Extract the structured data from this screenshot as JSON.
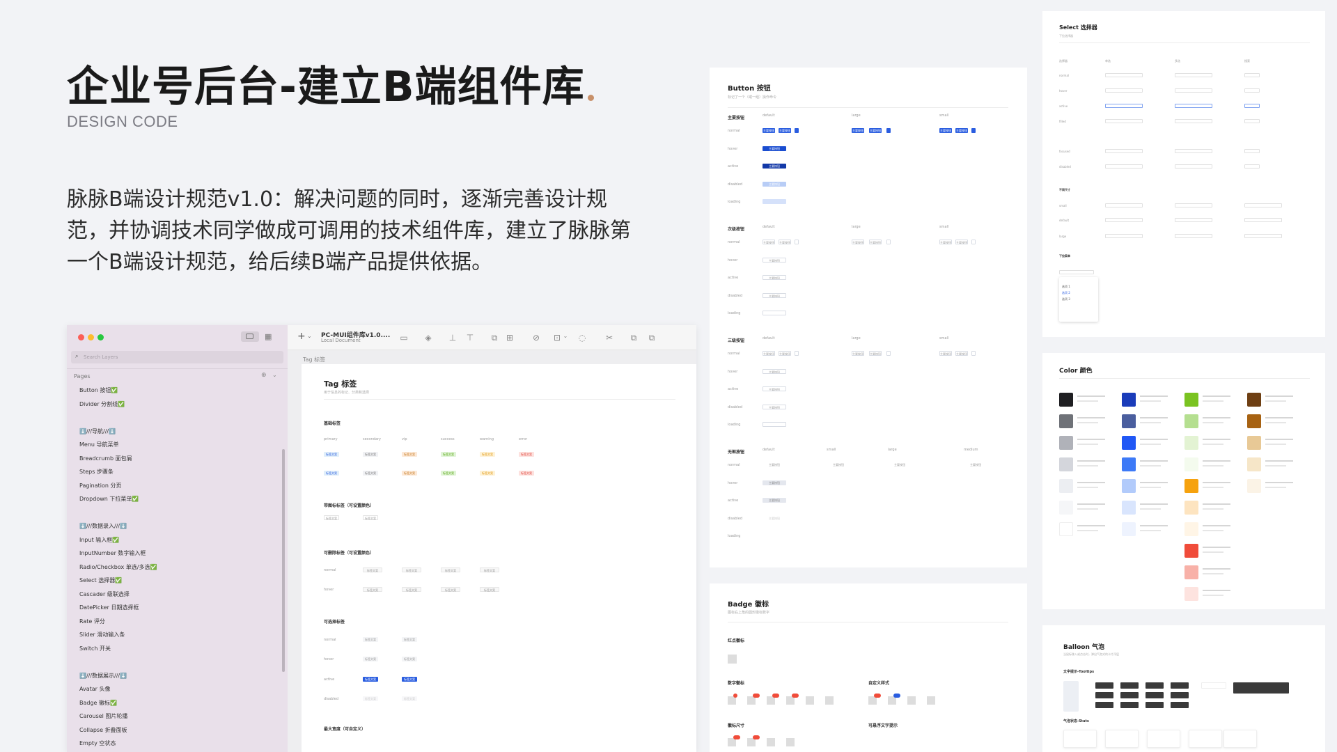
{
  "hero": {
    "title": "企业号后台-建立B端组件库",
    "subtitle": "DESIGN CODE",
    "description": "脉脉B端设计规范v1.0：解决问题的同时，逐渐完善设计规范，并协调技术同学做成可调用的技术组件库，建立了脉脉第一个B端设计规范，给后续B端产品提供依据。"
  },
  "sketch": {
    "search_placeholder": "Search Layers",
    "pages_label": "Pages",
    "doc_title": "PC-MUI组件库v1.0....",
    "doc_subtitle": "Local Document",
    "artboard_label": "Tag 标签",
    "groups": [
      [
        "Button 按钮✅",
        "Divider 分割线✅"
      ],
      [
        "⬇️///导航///⬇️",
        "Menu 导航菜单",
        "Breadcrumb 面包屑",
        "Steps 步骤条",
        "Pagination 分页",
        "Dropdown 下拉菜单✅"
      ],
      [
        "⬇️///数据录入///⬇️",
        "Input 输入框✅",
        "InputNumber 数字输入框",
        "Radio/Checkbox 单选/多选✅",
        "Select 选择器✅",
        "Cascader 级联选择",
        "DatePicker 日期选择框",
        "Rate 评分",
        "Slider 滑动输入条",
        "Switch 开关"
      ],
      [
        "⬇️///数据展示///⬇️",
        "Avatar 头像",
        "Badge 徽标✅",
        "Carousel 图片轮播",
        "Collapse 折叠面板",
        "Empty 空状态"
      ]
    ],
    "tag_card": {
      "title": "Tag 标签",
      "desc": "用于信息的标记、分类和选择",
      "s1": "基础标签",
      "cols": [
        "primary",
        "secondary",
        "vip",
        "success",
        "warning",
        "error"
      ],
      "tag_text": "标签文案",
      "s2": "带图标标签（可设置颜色）",
      "s3": "可删除标签（可设置颜色）",
      "s4": "可选择标签",
      "row_normal": "normal",
      "row_hover": "hover",
      "row_active": "active",
      "row_disabled": "disabled",
      "s5": "最大宽度（可自定义）"
    }
  },
  "button_card": {
    "title": "Button 按钮",
    "desc": "标记了一个（或一组）操作命令",
    "sections": [
      "主要按钮",
      "次级按钮",
      "三级按钮",
      "无框按钮"
    ],
    "sizes": [
      "default",
      "large",
      "small"
    ],
    "sizes4": [
      "default",
      "small",
      "large",
      "medium"
    ],
    "states": [
      "normal",
      "hover",
      "active",
      "disabled",
      "loading"
    ],
    "btn_text": "主要按钮"
  },
  "badge_card": {
    "title": "Badge 徽标",
    "desc": "图标右上角的圆形徽标数字",
    "s1": "红点徽标",
    "s2": "数字徽标",
    "s3": "自定义样式",
    "s4": "徽标尺寸",
    "s5": "可悬浮文字提示"
  },
  "select_card": {
    "title": "Select 选择器",
    "desc": "下拉选择器",
    "cols": [
      "选择器",
      "单选",
      "多选",
      "搜索"
    ],
    "rows": [
      "normal",
      "hover",
      "active",
      "filled",
      "focused",
      "disabled"
    ],
    "s2": "不同尺寸",
    "sizes": [
      "small",
      "default",
      "large"
    ],
    "s3": "下拉菜单",
    "opts": [
      "选项 1",
      "选项 2",
      "选项 3"
    ]
  },
  "color_card": {
    "title": "Color 颜色",
    "colors": [
      "#1f1f22",
      "#6f7278",
      "#b0b2b9",
      "#d4d6dc",
      "#eceef2",
      "#f5f6f8",
      "#ffffff",
      "#1a3cba",
      "#4a5e9e",
      "#2057f5",
      "#3d7af7",
      "#b2cbfb",
      "#d9e5fd",
      "#eef3fe",
      "#7ac321",
      "#b5df90",
      "#e3f3d3",
      "#f4fbee",
      "#f6a20e",
      "#fde4c0",
      "#fff5e6",
      "#f04c3a",
      "#f8b1a8",
      "#fde3df",
      "#6e3f13",
      "#a76212",
      "#e8c996",
      "#f6e6c8",
      "#fbf3e6"
    ],
    "cols": [
      7,
      7,
      10,
      5
    ]
  },
  "balloon_card": {
    "title": "Balloon 气泡",
    "desc": "当鼠标移入或点击时，弹出气泡式的卡片浮层",
    "s1": "文字提示-Tooltips",
    "s2": "气泡状态-Stats"
  }
}
